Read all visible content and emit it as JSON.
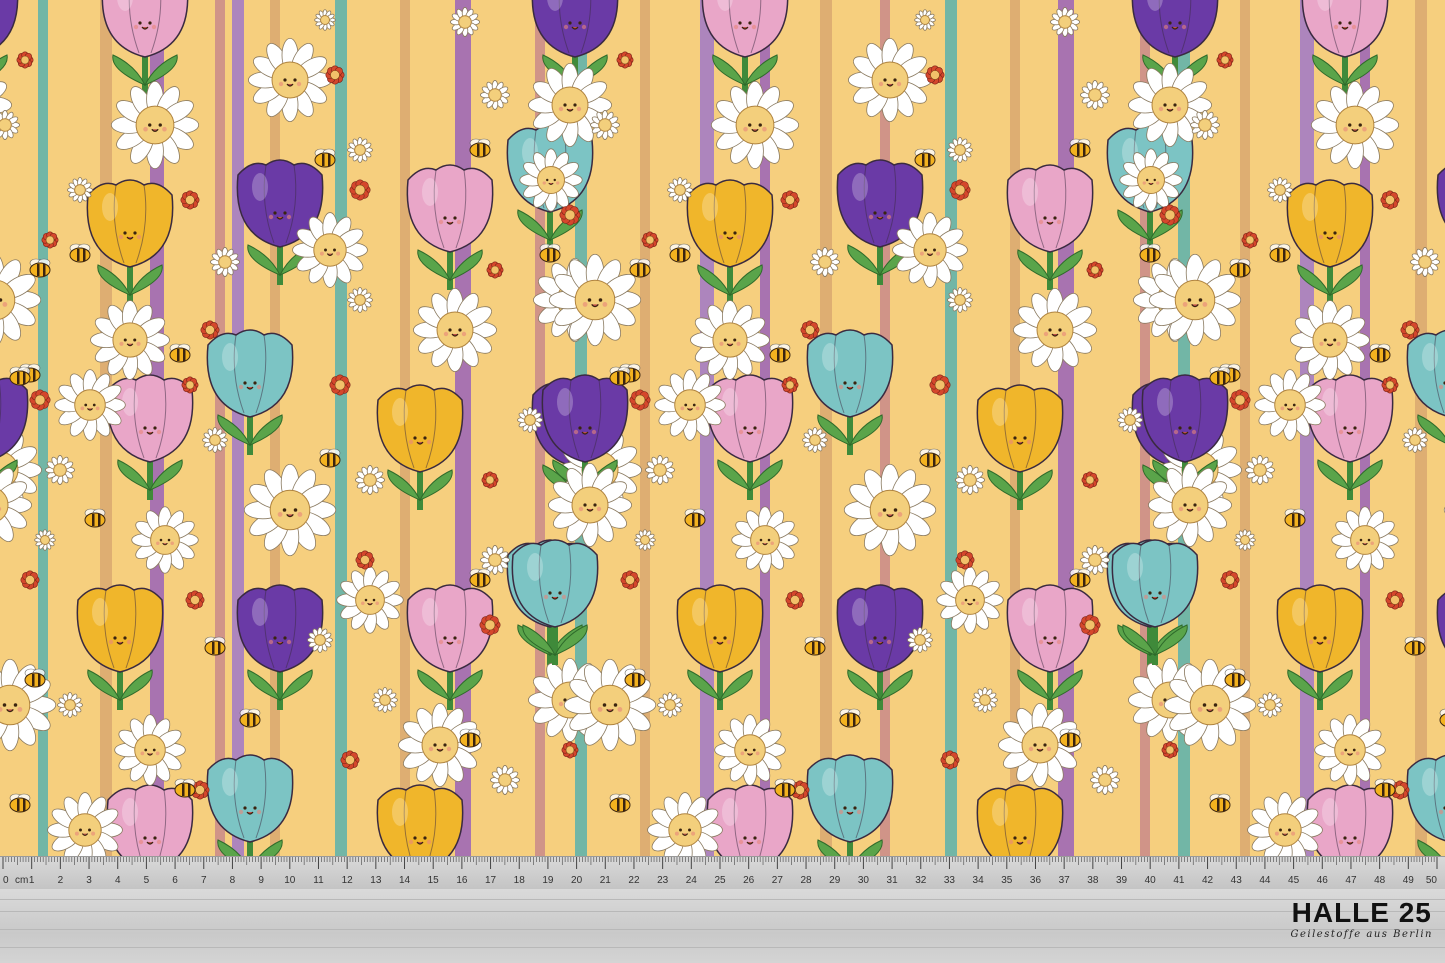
{
  "brand": {
    "title": "HALLE 25",
    "subtitle": "Geilestoffe aus Berlin"
  },
  "ruler": {
    "unit": "cm",
    "start": 0,
    "end": 50,
    "labels": [
      "0",
      "1",
      "2",
      "3",
      "4",
      "5",
      "6",
      "7",
      "8",
      "9",
      "10",
      "11",
      "12",
      "13",
      "14",
      "15",
      "16",
      "17",
      "18",
      "19",
      "20",
      "21",
      "22",
      "23",
      "24",
      "25",
      "26",
      "27",
      "28",
      "29",
      "30",
      "31",
      "32",
      "33",
      "34",
      "35",
      "36",
      "37",
      "38",
      "39",
      "40",
      "41",
      "42",
      "43",
      "44",
      "45",
      "46",
      "47",
      "48",
      "49",
      "50"
    ]
  },
  "fabric": {
    "background": "#f6cf7e",
    "stripe_colors": [
      "#9a63b8",
      "#5bb2ad",
      "#c98a8a",
      "#d9a870",
      "#a078c8"
    ],
    "motifs": [
      "purple-tulip-icon",
      "pink-tulip-icon",
      "yellow-tulip-icon",
      "teal-tulip-icon",
      "daisy-icon",
      "small-daisy-icon",
      "red-flower-icon",
      "bee-icon"
    ],
    "colors": {
      "purple": "#6a3aa6",
      "pink": "#e9a6c8",
      "yellow": "#f0b62b",
      "teal": "#7cc4c4",
      "daisy_petal": "#ffffff",
      "daisy_center": "#f3cf7c",
      "red_flower": "#d5472c",
      "leaf": "#3f8a3a"
    }
  }
}
